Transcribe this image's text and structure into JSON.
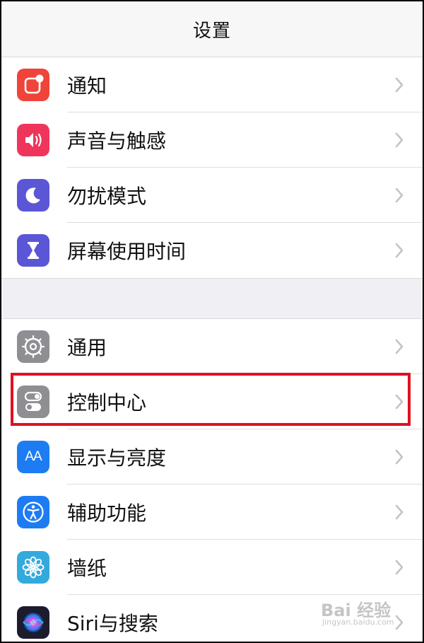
{
  "header": {
    "title": "设置"
  },
  "sections": [
    {
      "items": [
        {
          "label": "通知",
          "icon": "notifications-icon",
          "color": "#f0443a"
        },
        {
          "label": "声音与触感",
          "icon": "sound-icon",
          "color": "#f0355c"
        },
        {
          "label": "勿扰模式",
          "icon": "moon-icon",
          "color": "#5b56d6"
        },
        {
          "label": "屏幕使用时间",
          "icon": "hourglass-icon",
          "color": "#5b56d6"
        }
      ]
    },
    {
      "items": [
        {
          "label": "通用",
          "icon": "gear-icon",
          "color": "#8e8e93"
        },
        {
          "label": "控制中心",
          "icon": "toggle-icon",
          "color": "#8e8e93",
          "highlighted": true
        },
        {
          "label": "显示与亮度",
          "icon": "aa-text-icon",
          "color": "#1e7cf2"
        },
        {
          "label": "辅助功能",
          "icon": "accessibility-icon",
          "color": "#1e7cf2"
        },
        {
          "label": "墙纸",
          "icon": "flower-icon",
          "color": "#34aadc"
        },
        {
          "label": "Siri与搜索",
          "icon": "siri-icon",
          "color": "#1c1c2e"
        }
      ]
    }
  ],
  "icon_glyphs": {
    "aa_text": "AA"
  },
  "watermark": {
    "brand": "Bai 经验",
    "url": "jingyan.baidu.com"
  }
}
